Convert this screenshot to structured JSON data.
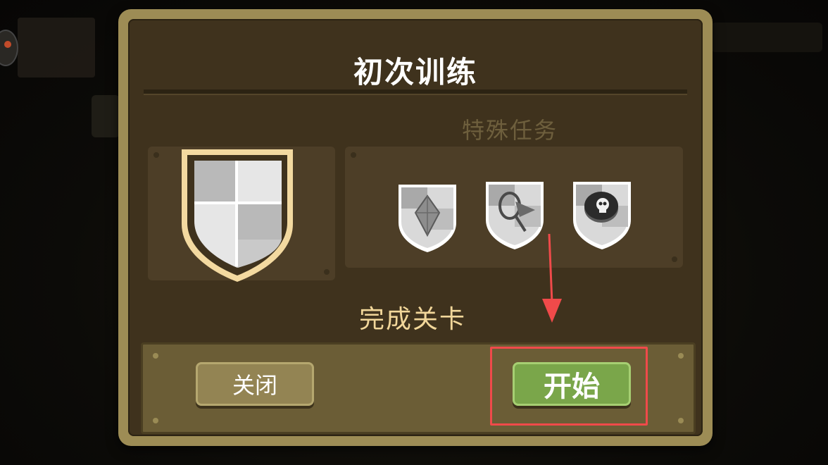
{
  "dialog": {
    "title": "初次训练",
    "special_tasks_label": "特殊任务",
    "complete_level_label": "完成关卡"
  },
  "buttons": {
    "close_label": "关闭",
    "start_label": "开始"
  },
  "icons": {
    "main_shield": "shield-icon",
    "task_1": "diamond-shield-icon",
    "task_2": "net-shield-icon",
    "task_3": "skull-coin-shield-icon"
  },
  "colors": {
    "frame": "#9d8c55",
    "panel": "#3f321d",
    "title_text": "#ffffff",
    "complete_text": "#f2d79a",
    "start_button": "#7aa64a",
    "close_button": "#938453",
    "highlight": "#f04a4a"
  }
}
